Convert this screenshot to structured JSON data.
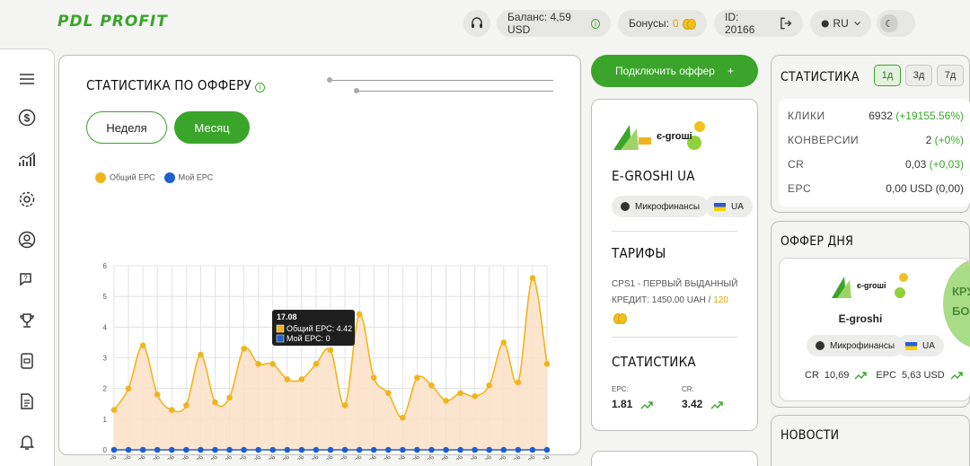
{
  "header": {
    "logo": "PDL PROFIT",
    "balance_label": "Баланс: 4,59 USD",
    "bonus_label": "Бонусы:",
    "bonus_value": "0",
    "id_label": "ID: 20166",
    "lang": "RU"
  },
  "offer_stats": {
    "title": "СТАТИСТИКА ПО ОФФЕРУ",
    "week_label": "Неделя",
    "month_label": "Месяц",
    "legend_total": "Общий EPC",
    "legend_mine": "Мой EPC",
    "tooltip_date": "17.08",
    "tooltip_total": "Общий EPC: 4.42",
    "tooltip_mine": "Мой EPC: 0"
  },
  "chart_data": {
    "type": "area",
    "categories": [
      "31-07-2026",
      "01-08-2026",
      "02-08-2026",
      "03-08-2026",
      "04-08-2026",
      "05-08-2026",
      "06-08-2026",
      "07-08-2026",
      "08-08-2026",
      "09-08-2026",
      "10-08-2026",
      "11-08-2026",
      "12-08-2026",
      "13-08-2026",
      "14-08-2026",
      "15-08-2026",
      "16-08-2026",
      "17-08-2026",
      "18-08-2026",
      "19-08-2026",
      "20-08-2026",
      "21-08-2026",
      "22-08-2026",
      "23-08-2026",
      "24-08-2026",
      "25-08-2026",
      "26-08-2026",
      "27-08-2026",
      "28-08-2026",
      "29-08-2026",
      "30-08-2026"
    ],
    "series": [
      {
        "name": "Общий EPC",
        "color": "#f0b51e",
        "values": [
          1.3,
          2.0,
          3.4,
          1.8,
          1.3,
          1.45,
          3.1,
          1.55,
          1.7,
          3.3,
          2.8,
          2.8,
          2.3,
          2.3,
          2.8,
          3.25,
          1.45,
          4.42,
          2.35,
          1.85,
          1.05,
          2.35,
          2.1,
          1.6,
          1.85,
          1.75,
          2.1,
          3.5,
          2.2,
          5.6,
          2.8
        ]
      },
      {
        "name": "Мой EPC",
        "color": "#1f5fd0",
        "values": [
          0,
          0,
          0,
          0,
          0,
          0,
          0,
          0,
          0,
          0,
          0,
          0,
          0,
          0,
          0,
          0,
          0,
          0,
          0,
          0,
          0,
          0,
          0,
          0,
          0,
          0,
          0,
          0,
          0,
          0,
          0
        ]
      }
    ],
    "yticks": [
      "0",
      "1",
      "2",
      "3",
      "4",
      "5",
      "6"
    ],
    "ylim": [
      0,
      6
    ],
    "grid": true,
    "legend": "top-left"
  },
  "connect_offer": {
    "label": "Подключить оффер",
    "plus": "+"
  },
  "offer_card": {
    "logo_text": "є-grоші",
    "name": "E-GROSHI UA",
    "category": "Микрофинансы",
    "geo": "UA",
    "tariffs_title": "ТАРИФЫ",
    "tariff_line1": "CPS1 - ПЕРВЫЙ ВЫДАННЫЙ",
    "tariff_line2": "КРЕДИТ: 1450.00 UAH",
    "tariff_sep": "/",
    "tariff_bonus": "120",
    "stats_title": "СТАТИСТИКА",
    "epc_label": "EPC:",
    "epc_value": "1.81",
    "cr_label": "CR:",
    "cr_value": "3.42"
  },
  "stats_panel": {
    "title": "СТАТИСТИКА",
    "periods": [
      "1д",
      "3д",
      "7д"
    ],
    "rows": [
      {
        "label": "КЛИКИ",
        "value": "6932",
        "delta": "(+19155.56%)"
      },
      {
        "label": "КОНВЕРСИИ",
        "value": "2",
        "delta": "(+0%)"
      },
      {
        "label": "CR",
        "value": "0,03",
        "delta": "(+0,03)"
      },
      {
        "label": "EPC",
        "value": "0,00 USD",
        "delta": "(0,00)"
      }
    ]
  },
  "offer_of_day": {
    "title": "ОФФЕР ДНЯ",
    "name": "E-groshi",
    "category": "Микрофинансы",
    "geo": "UA",
    "cr_label": "CR",
    "cr_value": "10,69",
    "epc_label": "EPC",
    "epc_value": "5,63 USD",
    "badge_line1": "КРУ",
    "badge_line2": "БО"
  },
  "news": {
    "title": "НОВОСТИ"
  },
  "colors": {
    "accent": "#3aa52a",
    "chart_total": "#f0b51e",
    "chart_mine": "#1f5fd0"
  }
}
